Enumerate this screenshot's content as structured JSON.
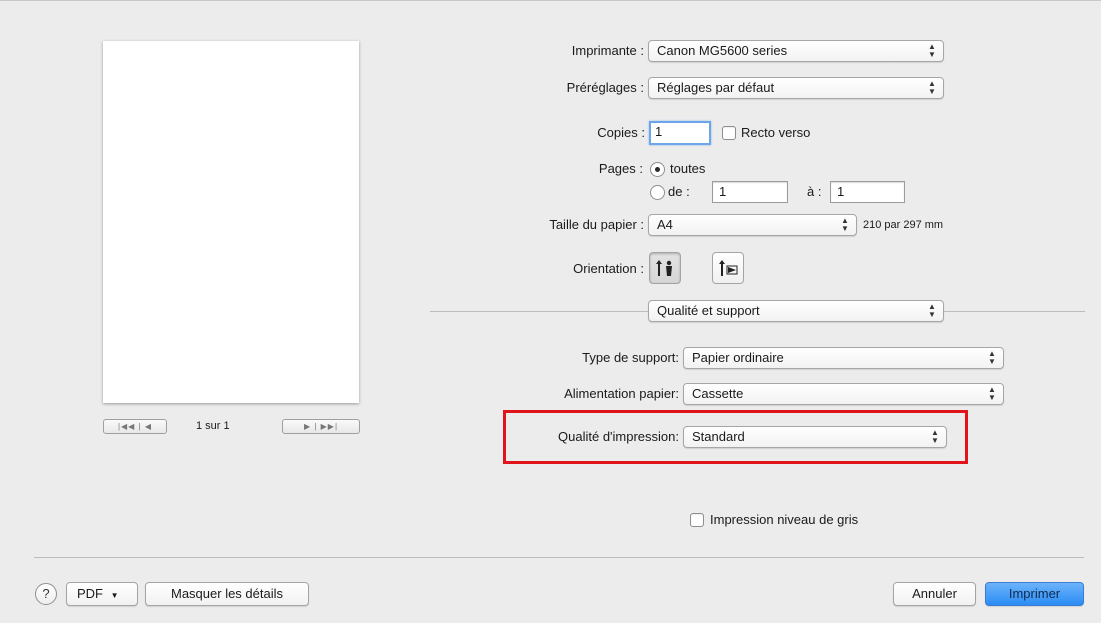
{
  "printer": {
    "label": "Imprimante :",
    "value": "Canon MG5600 series"
  },
  "presets": {
    "label": "Préréglages :",
    "value": "Réglages par défaut"
  },
  "copies": {
    "label": "Copies :",
    "value": "1",
    "duplex_label": "Recto verso",
    "duplex_checked": false
  },
  "pages": {
    "label": "Pages :",
    "all_label": "toutes",
    "from_label": "de :",
    "from_value": "1",
    "to_label": "à :",
    "to_value": "1",
    "selected": "all"
  },
  "paper_size": {
    "label": "Taille du papier :",
    "value": "A4",
    "dimensions": "210 par 297 mm"
  },
  "orientation": {
    "label": "Orientation :",
    "options": [
      "portrait-icon",
      "landscape-icon"
    ],
    "selected": "portrait"
  },
  "section": {
    "value": "Qualité et support"
  },
  "media_type": {
    "label": "Type de support:",
    "value": "Papier ordinaire"
  },
  "paper_source": {
    "label": "Alimentation papier:",
    "value": "Cassette"
  },
  "print_quality": {
    "label": "Qualité d'impression:",
    "value": "Standard"
  },
  "grayscale": {
    "label": "Impression niveau de gris",
    "checked": false
  },
  "preview": {
    "page_counter": "1 sur 1"
  },
  "footer": {
    "help": "?",
    "pdf": "PDF",
    "hide_details": "Masquer les détails",
    "cancel": "Annuler",
    "print": "Imprimer"
  },
  "colors": {
    "highlight": "#e0141a",
    "default_button": "#2a8cf4"
  }
}
